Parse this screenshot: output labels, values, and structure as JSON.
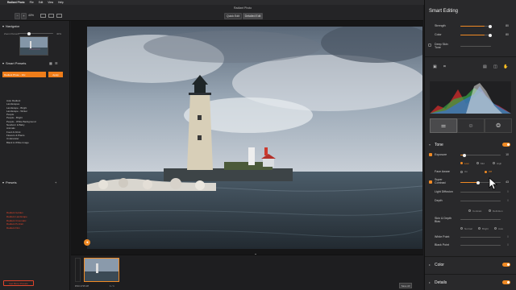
{
  "menubar": {
    "apple": "",
    "app": "Radiant Photo",
    "items": [
      "File",
      "Edit",
      "View",
      "Help"
    ]
  },
  "toolbar": {
    "zoom": "40%",
    "quick_edit": "Quick Edit",
    "detailed_edit": "Detailed Edit",
    "app_title": "Radiant Photo"
  },
  "navigator": {
    "title": "Navigator",
    "zoom_label": "Zoom Percent",
    "zoom_value": "40%"
  },
  "smart_presets": {
    "title": "Smart Presets",
    "selected": "Radiant Photo - 10x",
    "apply_label": "Apply",
    "items": [
      "Auto Radiant",
      "Landscapes",
      "Landscape - Bright",
      "Landscape - Winter",
      "People",
      "People - Bright",
      "People - White Background",
      "Newborn & Baby",
      "Animals",
      "Food & Drink",
      "Flowers & Plants",
      "Underwater",
      "Black & White Image"
    ]
  },
  "presets": {
    "title": "Presets",
    "items": [
      "Radiant Golden",
      "Radiant Landscape",
      "Radiant Cinematic",
      "Radiant Portrait",
      "Radiant Film"
    ]
  },
  "bottom_left": {
    "get_more": "Get More Presets"
  },
  "filmstrip": {
    "filename": "DSC1725.tiff",
    "page": "1 / 1",
    "save_label": "Save All"
  },
  "right_panel": {
    "title": "Smart Editing",
    "strength_label": "Strength",
    "strength_value": "80",
    "strength": 0.8,
    "color_label": "Color",
    "color_value": "80",
    "color": 0.8,
    "deep_skin_label": "Deep Skin Tone",
    "tone_title": "Tone",
    "exposure_label": "Exposure",
    "exposure_value": "10",
    "exposure": 0.1,
    "exposure_opts": [
      "Low",
      "Mid",
      "High"
    ],
    "face_aware_label": "Face Aware",
    "face_opts": [
      "On",
      "Off"
    ],
    "super_contrast_label": "Super Contrast",
    "super_contrast_value": "43",
    "super_contrast": 0.43,
    "light_diffusion_label": "Light Diffusion",
    "light_diffusion_value": "0",
    "depth_label": "Depth",
    "depth_value": "0",
    "depth_opts": [
      "Contrast",
      "Definition"
    ],
    "skin_depth_label": "Skin & Depth Bias",
    "skin_opts": [
      "Normal",
      "Bright",
      "Auto"
    ],
    "white_point_label": "White Point",
    "white_point_value": "0",
    "black_point_label": "Black Point",
    "black_point_value": "0",
    "color_section": "Color",
    "details_section": "Details"
  },
  "colors": {
    "accent": "#f08a24",
    "bg": "#1c1c1e",
    "panel": "#29292b"
  }
}
